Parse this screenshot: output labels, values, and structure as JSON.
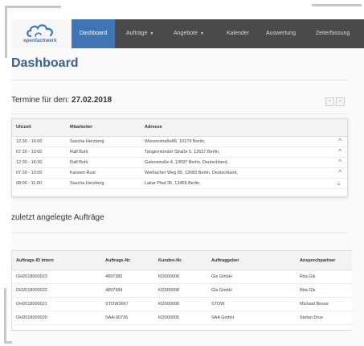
{
  "brand": {
    "logo_text": "openfachwerk",
    "logo_icon": "cloud-icon"
  },
  "nav": {
    "items": [
      {
        "label": "Dashboard",
        "active": true,
        "dropdown": false
      },
      {
        "label": "Aufträge",
        "active": false,
        "dropdown": true
      },
      {
        "label": "Angebote",
        "active": false,
        "dropdown": true
      },
      {
        "label": "Kalender",
        "active": false,
        "dropdown": false
      },
      {
        "label": "Auswertung",
        "active": false,
        "dropdown": false
      },
      {
        "label": "Zeiterfassung",
        "active": false,
        "dropdown": false
      }
    ]
  },
  "page": {
    "title": "Dashboard"
  },
  "termine": {
    "title_prefix": "Termine für den:",
    "date": "27.02.2018",
    "prev_icon": "chevron-left-icon",
    "next_icon": "chevron-right-icon",
    "columns": [
      "Uhrzeit",
      "Mitarbeiter",
      "Adresse"
    ],
    "rows": [
      {
        "time": "12:30 - 16:00",
        "employee": "Sascha Herzberg",
        "address": "Wiesenstraße86, 10179 Berlin,"
      },
      {
        "time": "07:30 - 10:00",
        "employee": "Ralf Buhl",
        "address": "Tangermünder Straße 5, 12627 Berlin,"
      },
      {
        "time": "12:30 - 16:30",
        "employee": "Ralf Buhl",
        "address": "Galenstraße 4, 13597 Berlin, Deutschland,"
      },
      {
        "time": "07:30 - 10:00",
        "employee": "Karsten Rust",
        "address": "Weißacher Weg 85, 12683 Berlin, Deutschland,"
      },
      {
        "time": "08:00 - 11:00",
        "employee": "Sascha Herzberg",
        "address": "Lakar Pfad 36, 13469 Berlin,"
      }
    ]
  },
  "auftraege": {
    "title": "zuletzt angelegte Aufträge",
    "columns": [
      "Auftrags-ID intern",
      "Auftrags-Nr.",
      "Kunden-Nr.",
      "Auftraggeber",
      "Ansprechpartner"
    ],
    "rows": [
      {
        "id": "OH2018000023",
        "nr": "4897385",
        "kunde": "KD000008",
        "auftraggeber": "Gls GmbH",
        "ansprechpartner": "Rita Gls"
      },
      {
        "id": "OH2018000022",
        "nr": "4897384",
        "kunde": "KD000008",
        "auftraggeber": "Gls GmbH",
        "ansprechpartner": "Rita Gls"
      },
      {
        "id": "OH2018000021",
        "nr": "STOW3667",
        "kunde": "KD000008",
        "auftraggeber": "STOW",
        "ansprechpartner": "Michael Besse"
      },
      {
        "id": "OH2018000020",
        "nr": "SAA-00736",
        "kunde": "KD000005",
        "auftraggeber": "SAA GmbH",
        "ansprechpartner": "Stefan Drux"
      }
    ]
  },
  "colors": {
    "nav_bg": "#4a4a4a",
    "nav_active": "#3f74b5",
    "title": "#3b5f8f"
  }
}
